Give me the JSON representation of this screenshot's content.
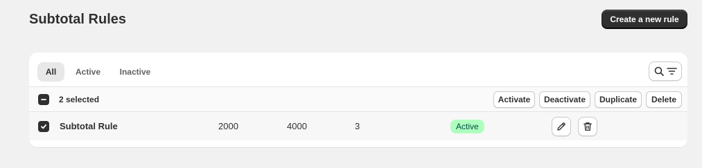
{
  "header": {
    "title": "Subtotal Rules",
    "create_button_label": "Create a new rule"
  },
  "tabs": [
    {
      "label": "All",
      "selected": true
    },
    {
      "label": "Active",
      "selected": false
    },
    {
      "label": "Inactive",
      "selected": false
    }
  ],
  "toolbar": {
    "filter_icons": [
      "search-icon",
      "filter-lines-icon"
    ]
  },
  "bulk_actions": {
    "selected_label": "2 selected",
    "buttons": [
      "Activate",
      "Deactivate",
      "Duplicate",
      "Delete"
    ]
  },
  "rows": [
    {
      "checked": true,
      "name": "Subtotal Rule",
      "min": "2000",
      "max": "4000",
      "count": "3",
      "status": "Active",
      "actions": [
        "edit-icon",
        "trash-icon"
      ]
    }
  ],
  "colors": {
    "primary_button": "#303030",
    "active_badge_bg": "#affebf",
    "active_badge_text": "#014b40",
    "page_bg": "#f1f1f1"
  }
}
